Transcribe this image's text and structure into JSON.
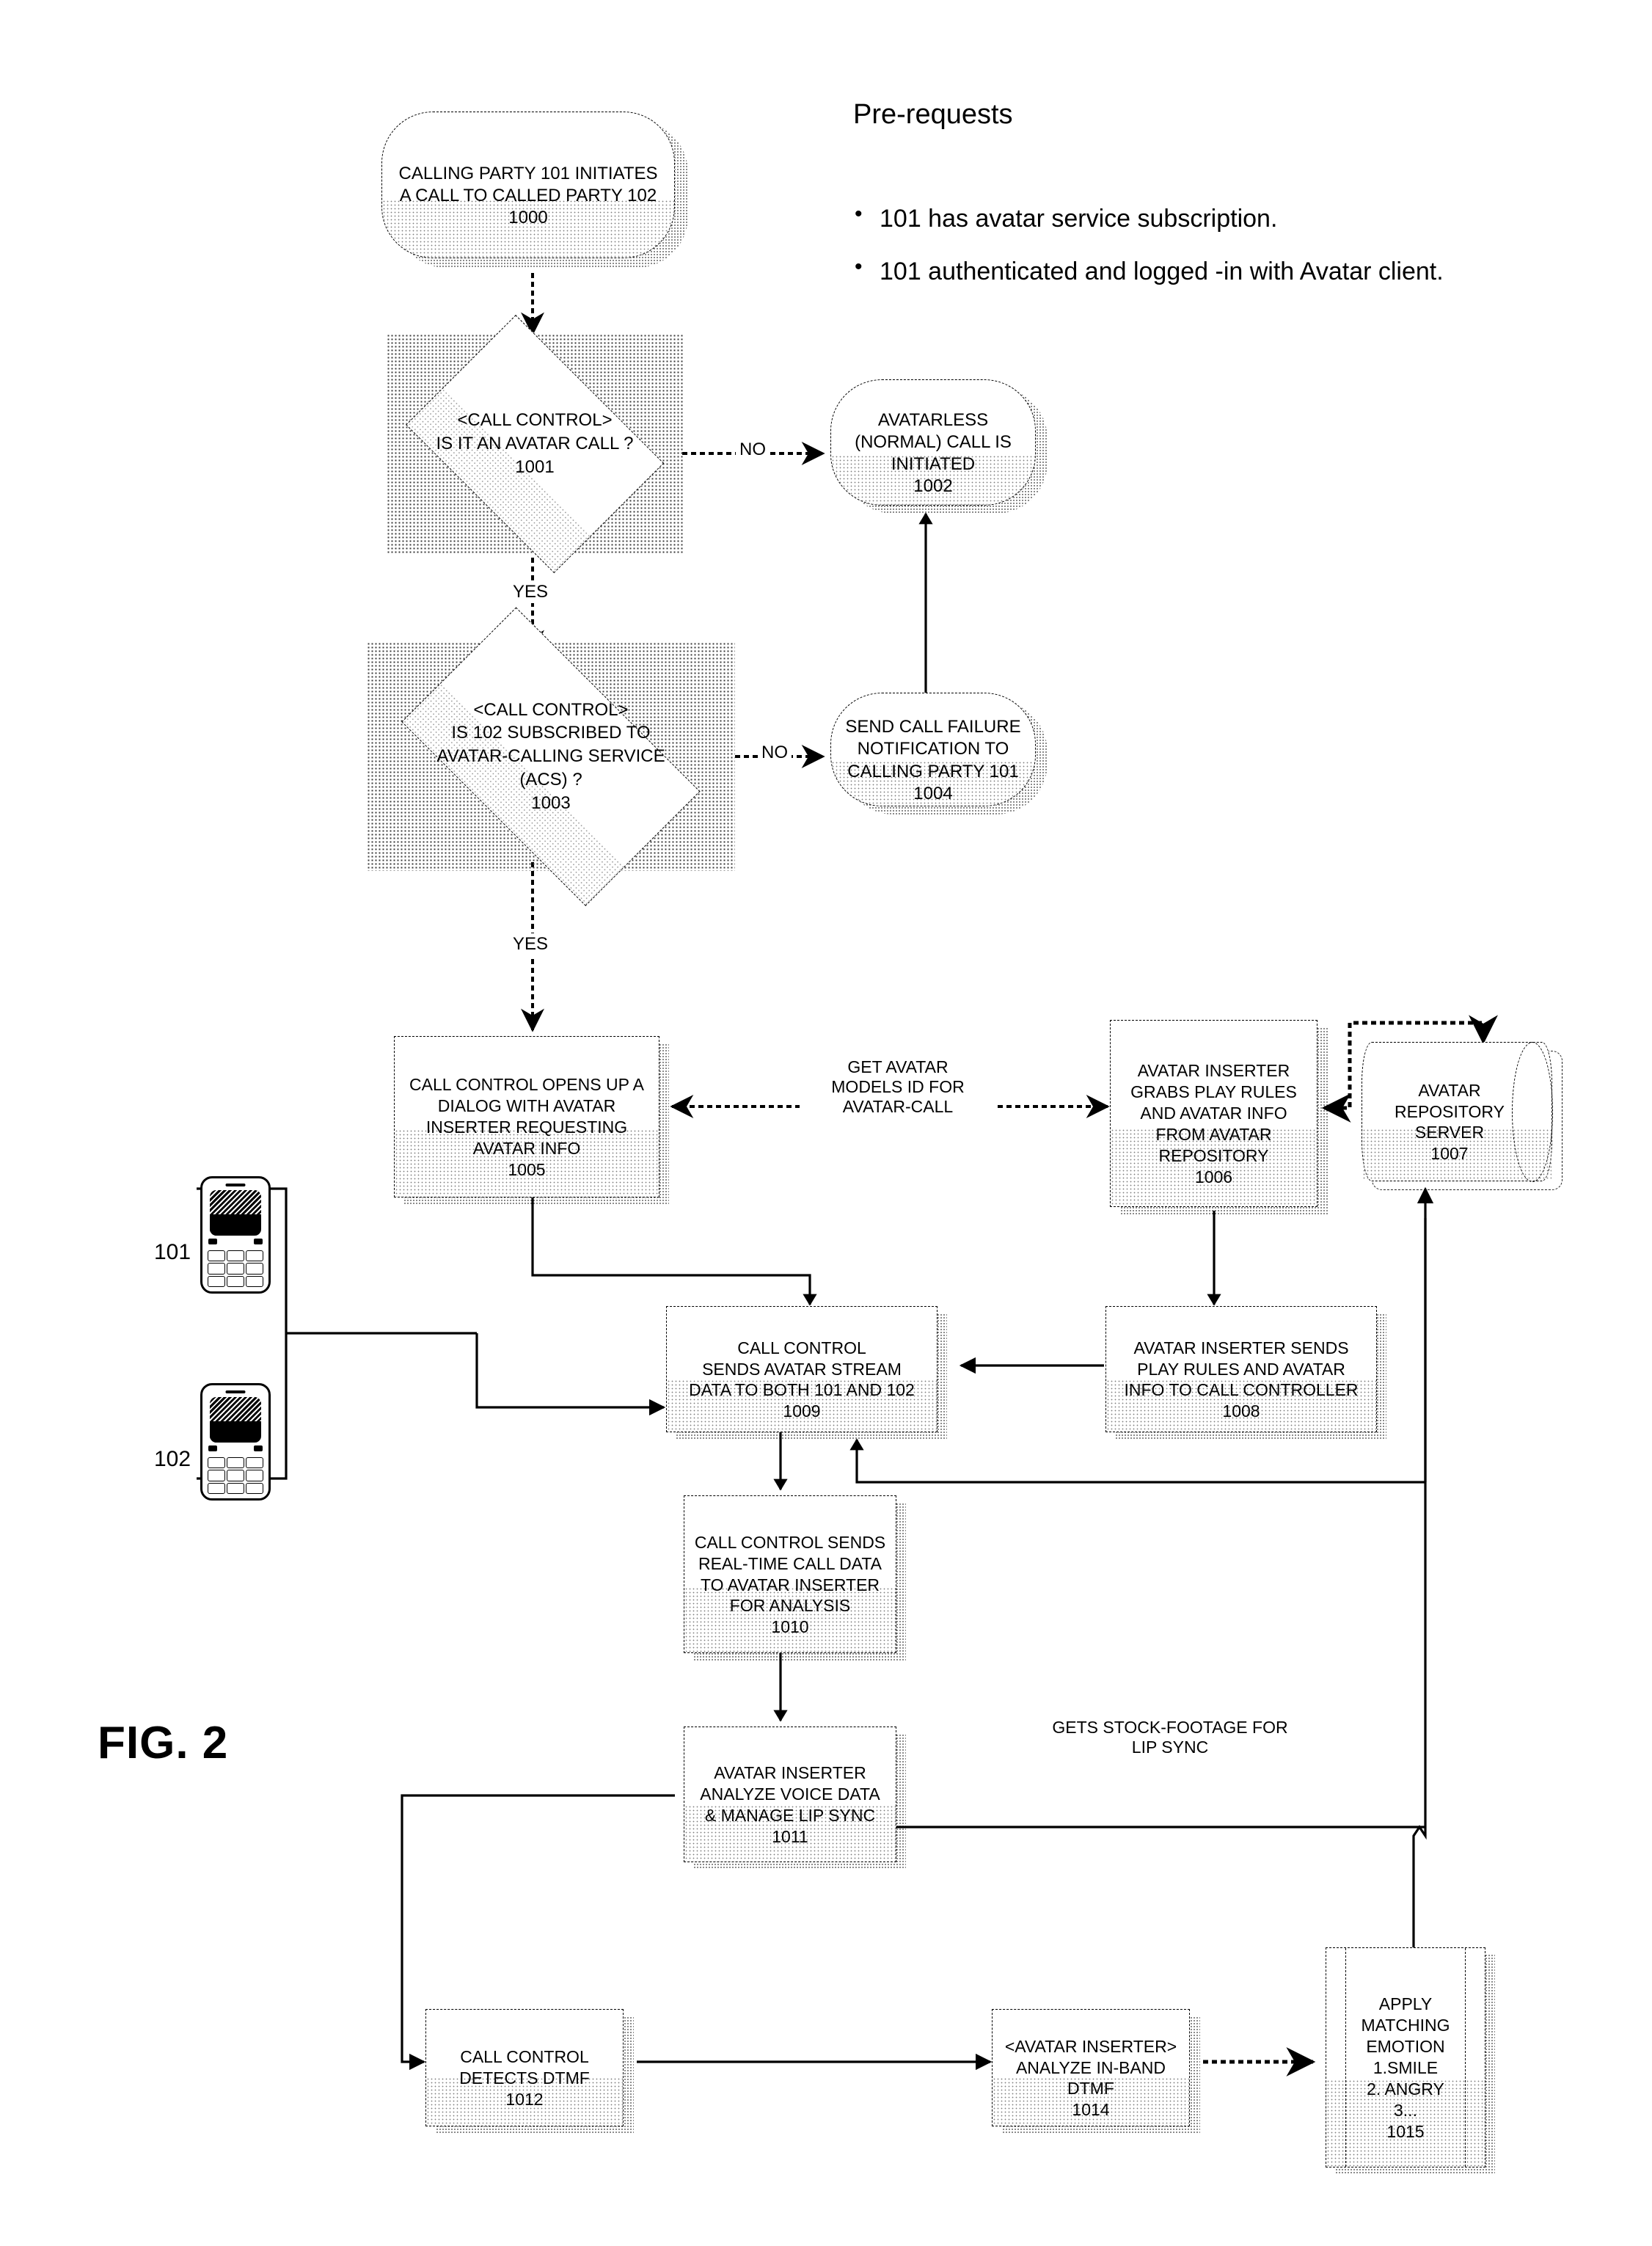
{
  "figure": {
    "label": "FIG. 2"
  },
  "header": {
    "title": "Pre-requests",
    "bullets": [
      "101 has avatar service subscription.",
      "101 authenticated and logged -in with Avatar client."
    ],
    "bullet_glyph": "•"
  },
  "actors": [
    {
      "id": "101",
      "name": "calling-party-handset",
      "label": "101"
    },
    {
      "id": "102",
      "name": "called-party-handset",
      "label": "102"
    }
  ],
  "nodes": [
    {
      "key": "n1000",
      "shape": "terminator",
      "text": "CALLING PARTY 101  INITIATES\nA CALL TO CALLED PARTY  102",
      "ref": "1000"
    },
    {
      "key": "n1001",
      "shape": "decision",
      "text": "<CALL CONTROL>\nIS IT AN AVATAR CALL ?",
      "ref": "1001"
    },
    {
      "key": "n1002",
      "shape": "terminator",
      "text": "AVATARLESS\n(NORMAL) CALL IS\nINITIATED",
      "ref": "1002"
    },
    {
      "key": "n1003",
      "shape": "decision",
      "text": "<CALL CONTROL>\nIS 102 SUBSCRIBED TO\nAVATAR-CALLING SERVICE\n(ACS) ?",
      "ref": "1003"
    },
    {
      "key": "n1004",
      "shape": "terminator",
      "text": "SEND CALL FAILURE\nNOTIFICATION TO\nCALLING PARTY 101",
      "ref": "1004"
    },
    {
      "key": "n1005",
      "shape": "process",
      "text": "CALL CONTROL OPENS UP A\nDIALOG WITH AVATAR\nINSERTER REQUESTING\nAVATAR INFO",
      "ref": "1005"
    },
    {
      "key": "n1006",
      "shape": "process",
      "text": "AVATAR INSERTER\nGRABS PLAY RULES\nAND AVATAR INFO\nFROM AVATAR\nREPOSITORY",
      "ref": "1006"
    },
    {
      "key": "n1007",
      "shape": "cylinder",
      "text": "AVATAR\nREPOSITORY\nSERVER",
      "ref": "1007"
    },
    {
      "key": "n1008",
      "shape": "process",
      "text": "AVATAR INSERTER SENDS\nPLAY RULES AND AVATAR\nINFO TO CALL CONTROLLER",
      "ref": "1008"
    },
    {
      "key": "n1009",
      "shape": "process",
      "text": "CALL CONTROL\nSENDS AVATAR STREAM\nDATA TO BOTH 101  AND 102",
      "ref": "1009"
    },
    {
      "key": "n1010",
      "shape": "process",
      "text": "CALL CONTROL SENDS\nREAL-TIME CALL DATA\nTO AVATAR INSERTER\nFOR ANALYSIS",
      "ref": "1010"
    },
    {
      "key": "n1011",
      "shape": "process",
      "text": "AVATAR INSERTER\nANALYZE VOICE DATA\n& MANAGE LIP SYNC",
      "ref": "1011"
    },
    {
      "key": "n1012",
      "shape": "process",
      "text": "CALL CONTROL\nDETECTS DTMF",
      "ref": "1012"
    },
    {
      "key": "n1014",
      "shape": "process",
      "text": "<AVATAR INSERTER>\nANALYZE IN-BAND\nDTMF",
      "ref": "1014"
    },
    {
      "key": "n1015",
      "shape": "predefined-process",
      "text": "APPLY\nMATCHING\nEMOTION\n1.SMILE\n2. ANGRY\n3...",
      "ref": "1015"
    }
  ],
  "edge_labels": {
    "no_1001": "NO",
    "yes_1001": "YES",
    "no_1003": "NO",
    "yes_1003": "YES",
    "get_avatar": "GET AVATAR\nMODELS ID FOR\nAVATAR-CALL",
    "stock_footage": "GETS STOCK-FOOTAGE FOR\nLIP SYNC"
  },
  "colors": {
    "ink": "#000000",
    "paper": "#ffffff",
    "shadow": "#4a4a4a",
    "fill_dots": "#808080"
  }
}
